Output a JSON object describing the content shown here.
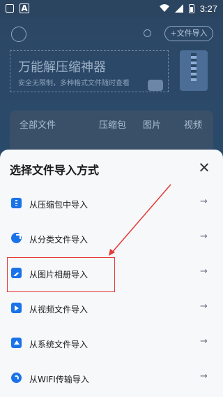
{
  "status_bar": {
    "time": "3:27",
    "icons": [
      "image-icon",
      "a-icon",
      "wifi-icon",
      "signal-icon",
      "battery-icon"
    ]
  },
  "background": {
    "import_button": "文件导入",
    "banner_title": "万能解压缩神器",
    "banner_subtitle": "安全无限制，多种格式文件随时查看",
    "tabs": [
      "全部文件",
      "压缩包",
      "图片",
      "视频"
    ]
  },
  "sheet": {
    "title": "选择文件导入方式",
    "options": [
      {
        "label": "从压缩包中导入",
        "icon": "zip-file-icon"
      },
      {
        "label": "从分类文件导入",
        "icon": "category-pie-icon"
      },
      {
        "label": "从图片相册导入",
        "icon": "image-album-icon"
      },
      {
        "label": "从视频文件导入",
        "icon": "video-file-icon"
      },
      {
        "label": "从系统文件导入",
        "icon": "system-upload-icon"
      },
      {
        "label": "从WIFI传输导入",
        "icon": "wifi-transfer-icon"
      }
    ],
    "arrow": "→"
  },
  "colors": {
    "accent": "#1a73e8",
    "highlight": "#e53935",
    "sheet_bg": "#f7f8fa",
    "dim_bg": "#2b4460"
  }
}
